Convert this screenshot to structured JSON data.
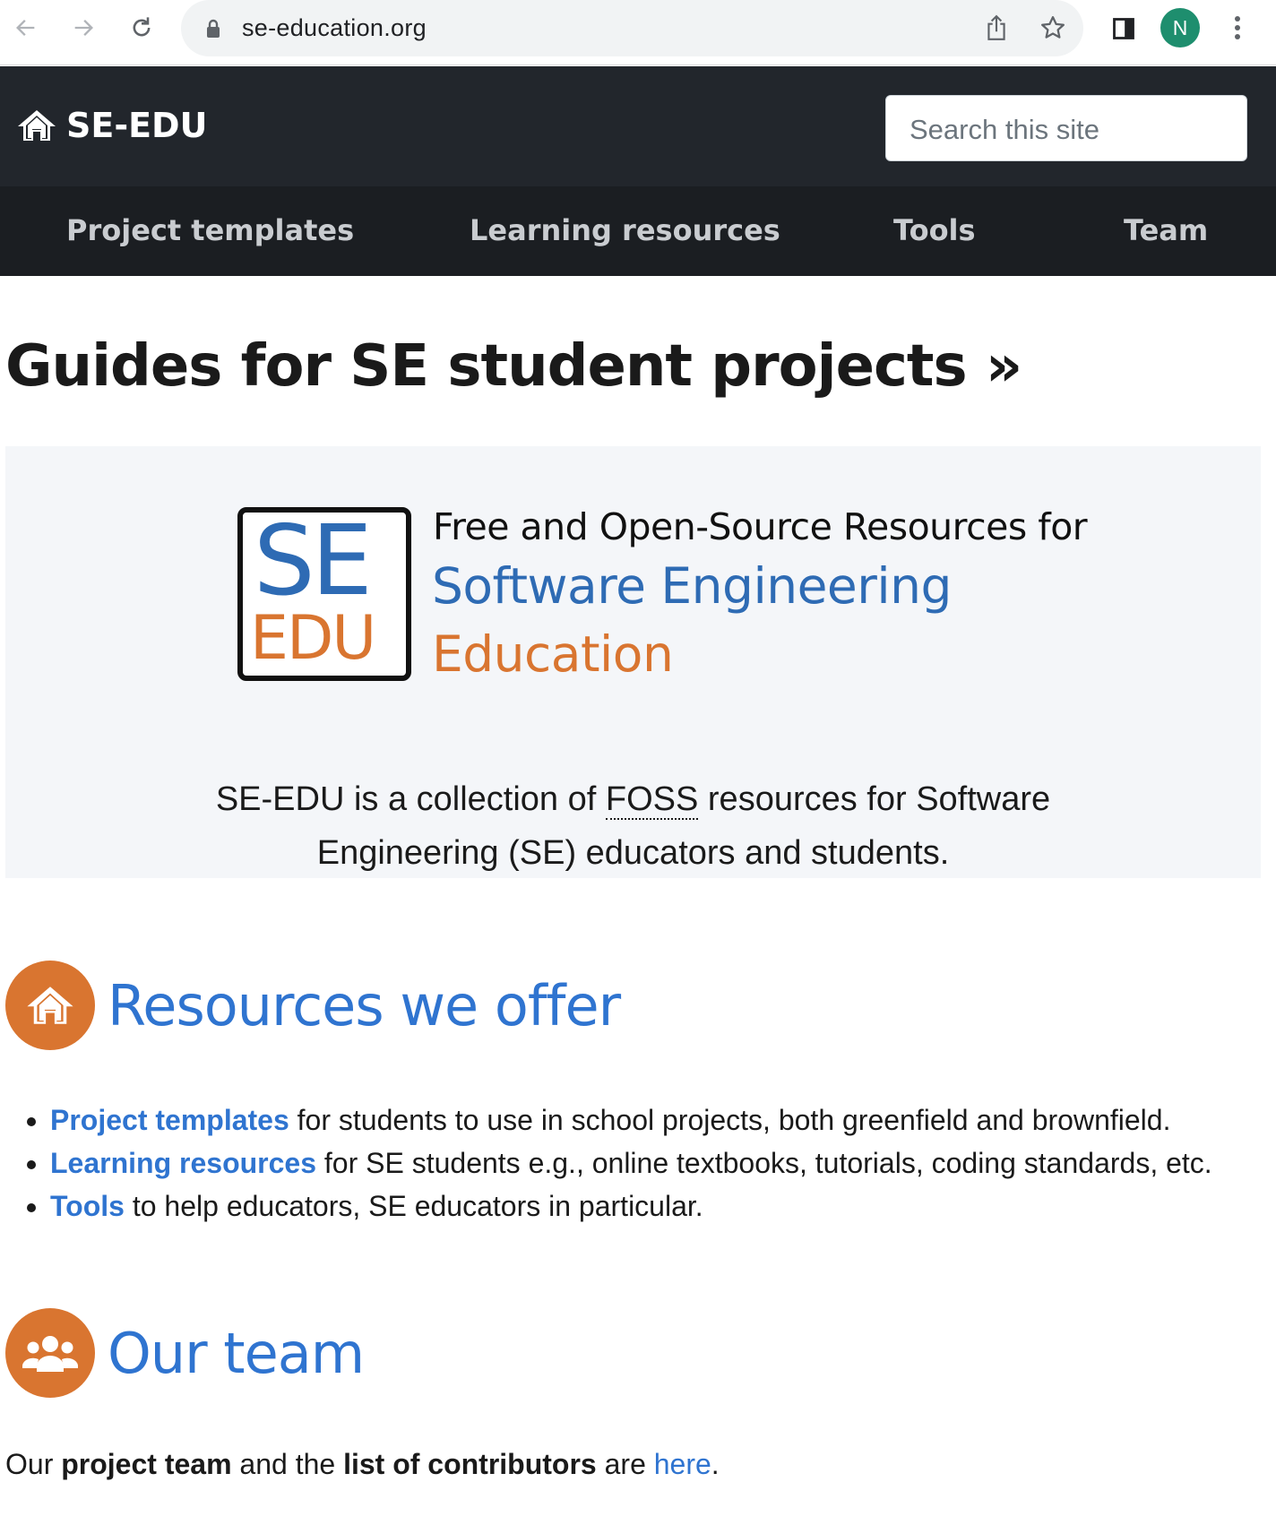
{
  "browser": {
    "url": "se-education.org",
    "profile_initial": "N"
  },
  "header": {
    "brand": "SE-EDU",
    "search_placeholder": "Search this site"
  },
  "nav": {
    "items": [
      "Project templates",
      "Learning resources",
      "Tools",
      "Team"
    ]
  },
  "page": {
    "title": "Guides for SE student projects »"
  },
  "hero": {
    "logo_top": "SE",
    "logo_bottom": "EDU",
    "tagline_1": "Free and Open-Source Resources for",
    "tagline_2": "Software Engineering",
    "tagline_3": "Education",
    "desc_before": "SE-EDU is a collection of ",
    "desc_foss": "FOSS",
    "desc_line1_after": " resources for Software",
    "desc_line2": "Engineering (SE) educators and students."
  },
  "resources": {
    "heading": "Resources we offer",
    "items": [
      {
        "link": "Project templates",
        "text": " for students to use in school projects, both greenfield and brownfield."
      },
      {
        "link": "Learning resources",
        "text": " for SE students e.g., online textbooks, tutorials, coding standards, etc."
      },
      {
        "link": "Tools",
        "text": " to help educators, SE educators in particular."
      }
    ]
  },
  "team": {
    "heading": "Our team",
    "t1": "Our ",
    "b1": "project team",
    "t2": " and the ",
    "b2": "list of contributors",
    "t3": " are ",
    "link": "here",
    "t4": "."
  },
  "colors": {
    "accent_blue": "#2f74d0",
    "accent_orange": "#d97530",
    "header_dark": "#22262c"
  }
}
